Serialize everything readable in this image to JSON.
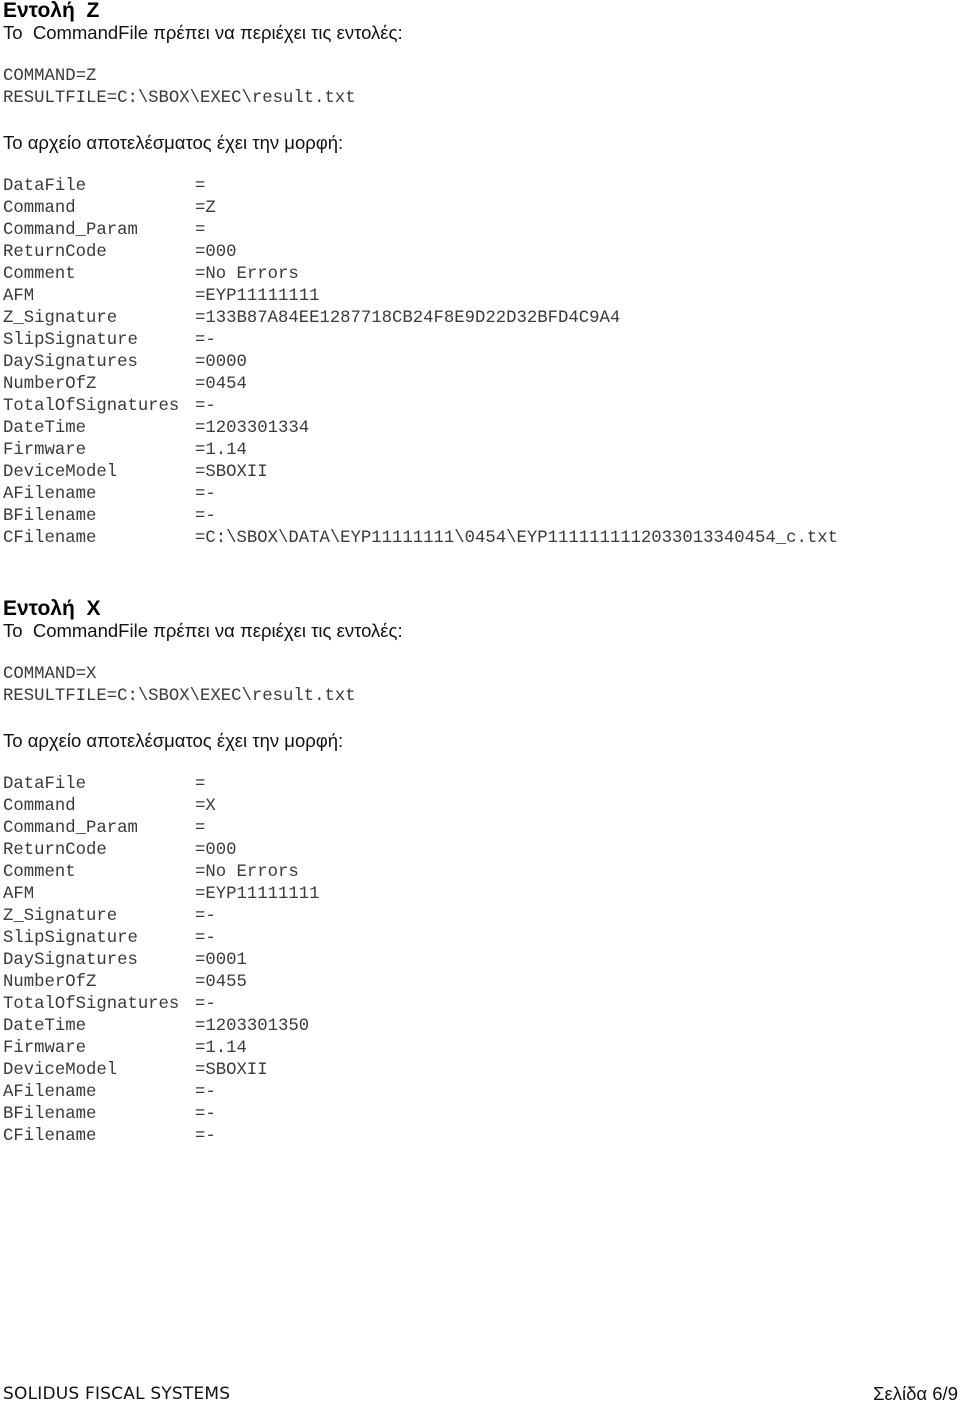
{
  "sections": [
    {
      "heading": "Εντολή  Z",
      "intro": "Το  CommandFile πρέπει να περιέχει τις εντολές:",
      "command_lines": [
        "COMMAND=Z",
        "RESULTFILE=C:\\SBOX\\EXEC\\result.txt"
      ],
      "result_intro": "Το αρχείο αποτελέσματος έχει την μορφή:",
      "result_fields": [
        {
          "key": "DataFile",
          "value": "="
        },
        {
          "key": "Command",
          "value": "=Z"
        },
        {
          "key": "Command_Param",
          "value": "="
        },
        {
          "key": "ReturnCode",
          "value": "=000"
        },
        {
          "key": "Comment",
          "value": "=No Errors"
        },
        {
          "key": "AFM",
          "value": "=EYP11111111"
        },
        {
          "key": "Z_Signature",
          "value": "=133B87A84EE1287718CB24F8E9D22D32BFD4C9A4"
        },
        {
          "key": "SlipSignature",
          "value": "=-"
        },
        {
          "key": "DaySignatures",
          "value": "=0000"
        },
        {
          "key": "NumberOfZ",
          "value": "=0454"
        },
        {
          "key": "TotalOfSignatures",
          "value": "=-"
        },
        {
          "key": "DateTime",
          "value": "=1203301334"
        },
        {
          "key": "Firmware",
          "value": "=1.14"
        },
        {
          "key": "DeviceModel",
          "value": "=SBOXII"
        },
        {
          "key": "AFilename",
          "value": "=-"
        },
        {
          "key": "BFilename",
          "value": "=-"
        },
        {
          "key": "CFilename",
          "value": "=C:\\SBOX\\DATA\\EYP11111111\\0454\\EYP1111111112033013340454_c.txt"
        }
      ]
    },
    {
      "heading": "Εντολή  X",
      "intro": "Το  CommandFile πρέπει να περιέχει τις εντολές:",
      "command_lines": [
        "COMMAND=X",
        "RESULTFILE=C:\\SBOX\\EXEC\\result.txt"
      ],
      "result_intro": "Το αρχείο αποτελέσματος έχει την μορφή:",
      "result_fields": [
        {
          "key": "DataFile",
          "value": "="
        },
        {
          "key": "Command",
          "value": "=X"
        },
        {
          "key": "Command_Param",
          "value": "="
        },
        {
          "key": "ReturnCode",
          "value": "=000"
        },
        {
          "key": "Comment",
          "value": "=No Errors"
        },
        {
          "key": "AFM",
          "value": "=EYP11111111"
        },
        {
          "key": "Z_Signature",
          "value": "=-"
        },
        {
          "key": "SlipSignature",
          "value": "=-"
        },
        {
          "key": "DaySignatures",
          "value": "=0001"
        },
        {
          "key": "NumberOfZ",
          "value": "=0455"
        },
        {
          "key": "TotalOfSignatures",
          "value": "=-"
        },
        {
          "key": "DateTime",
          "value": "=1203301350"
        },
        {
          "key": "Firmware",
          "value": "=1.14"
        },
        {
          "key": "DeviceModel",
          "value": "=SBOXII"
        },
        {
          "key": "AFilename",
          "value": "=-"
        },
        {
          "key": "BFilename",
          "value": "=-"
        },
        {
          "key": "CFilename",
          "value": "=-"
        }
      ]
    }
  ],
  "footer": {
    "brand": "SOLIDUS FISCAL SYSTEMS",
    "page_label": "Σελίδα 6/9"
  }
}
